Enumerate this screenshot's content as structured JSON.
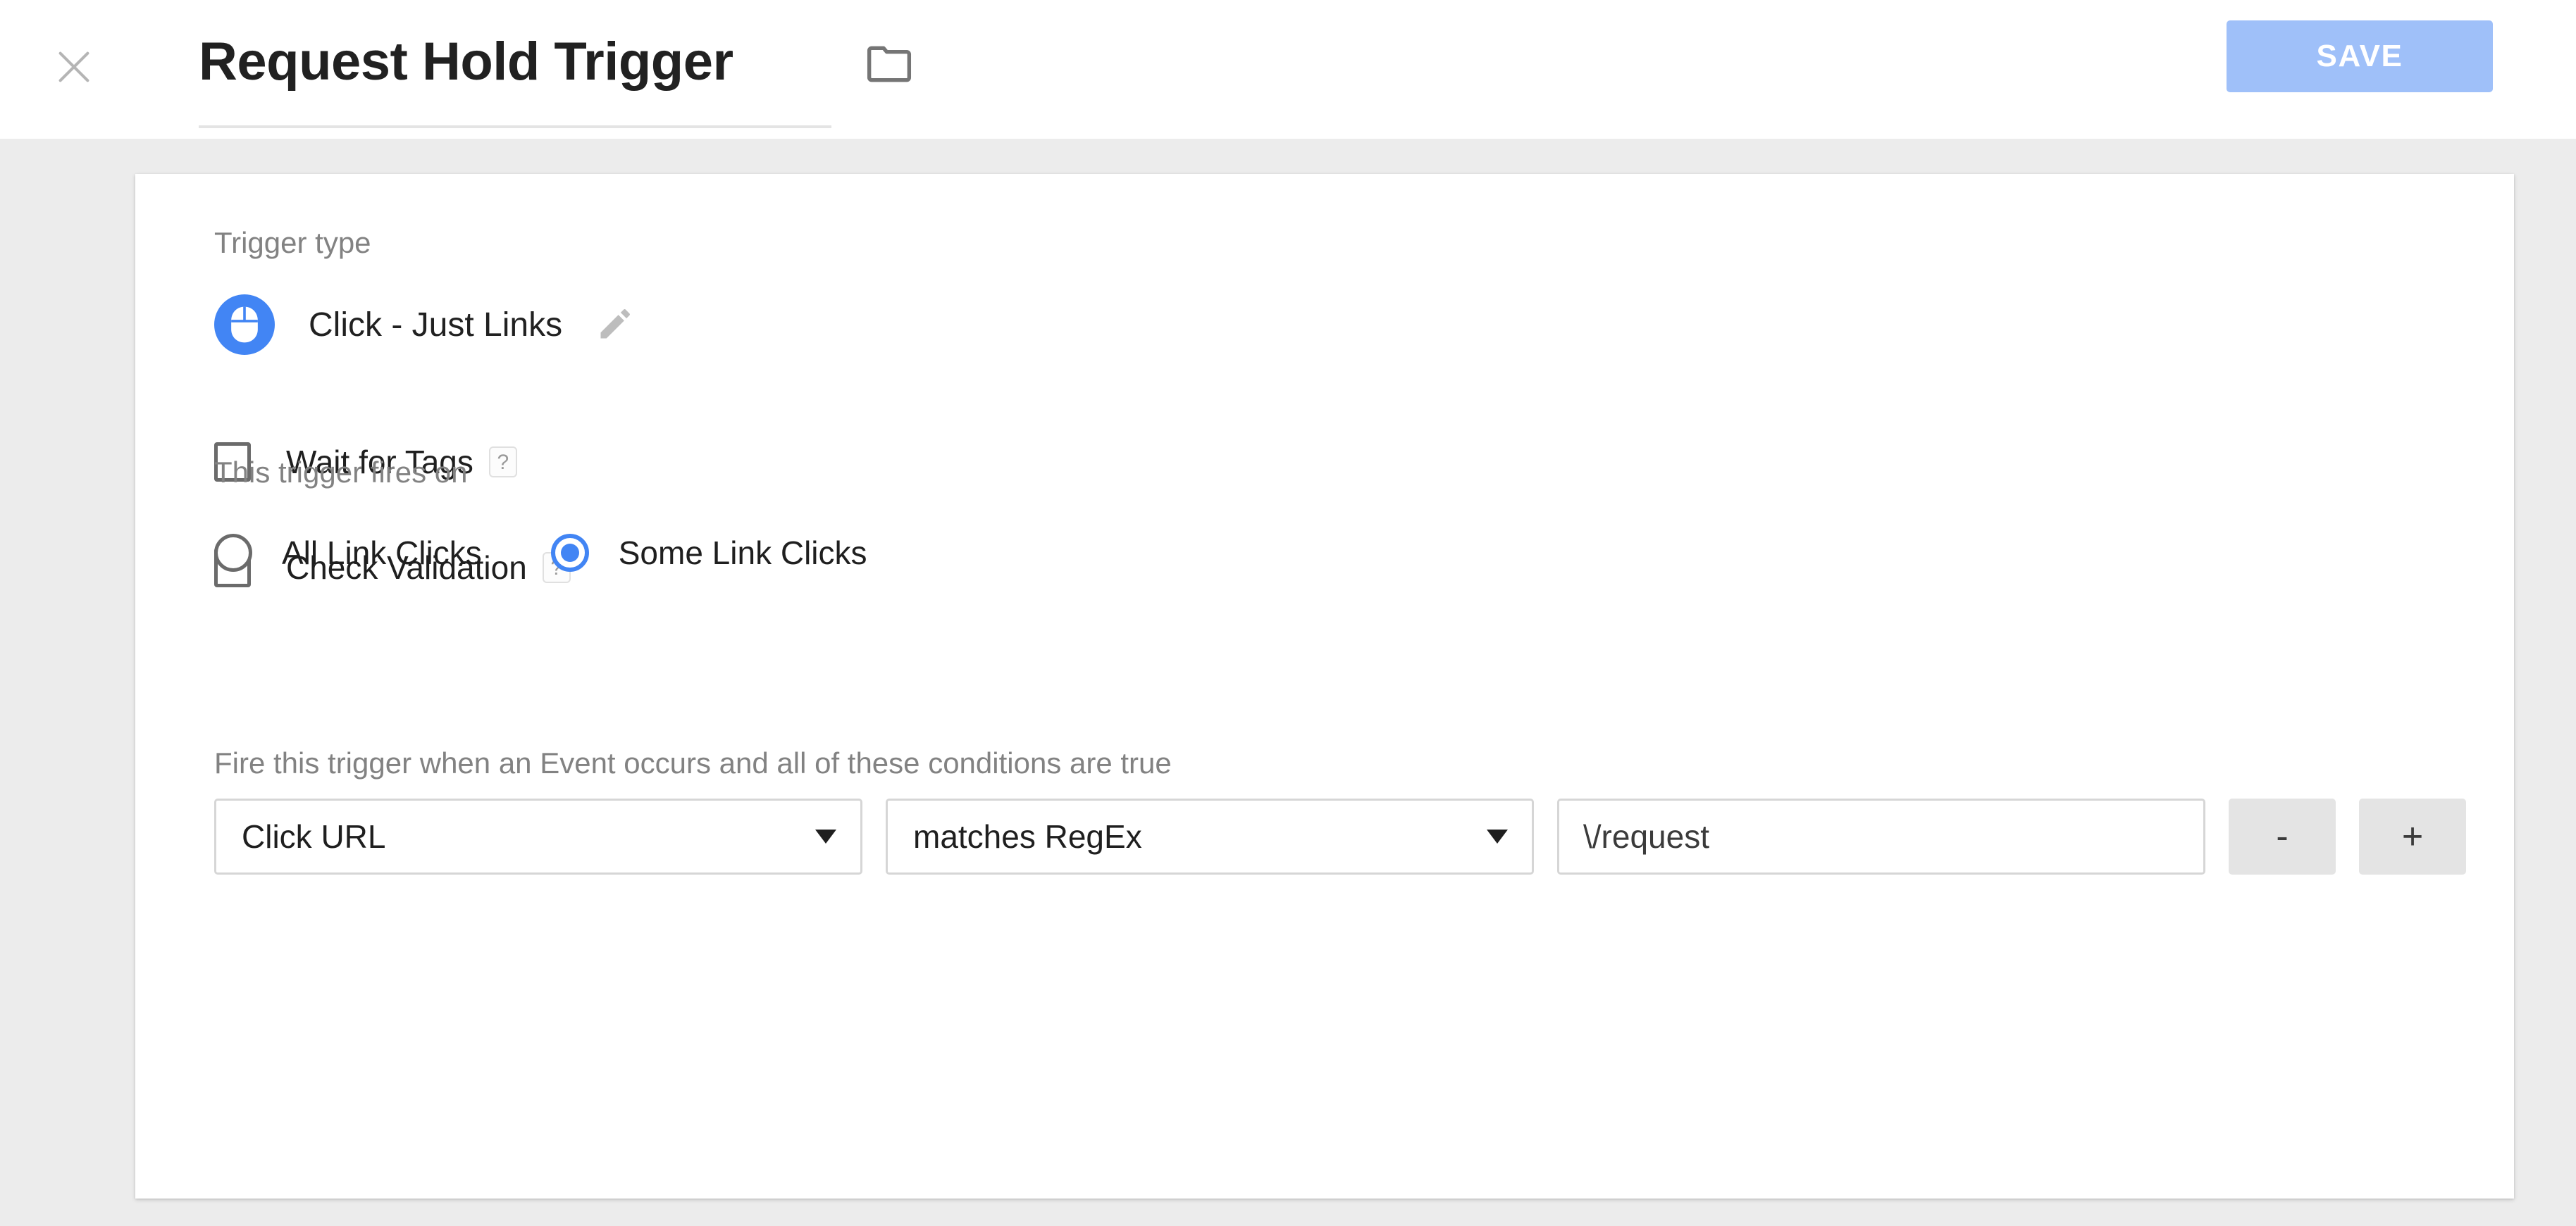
{
  "header": {
    "close_icon": "close-icon",
    "title": "Request Hold Trigger",
    "folder_icon": "folder-icon",
    "save_label": "SAVE",
    "save_color": "#9fc0f9"
  },
  "form": {
    "trigger_type_label": "Trigger type",
    "trigger_type": {
      "icon": "mouse-icon",
      "icon_color": "#4285f4",
      "name": "Click - Just Links",
      "edit_icon": "pencil-icon"
    },
    "options": [
      {
        "label": "Wait for Tags",
        "checked": false,
        "help": "?"
      },
      {
        "label": "Check Validation",
        "checked": false,
        "help": "?"
      }
    ],
    "fires_on_label": "This trigger fires on",
    "fires_on_options": [
      {
        "label": "All Link Clicks",
        "selected": false
      },
      {
        "label": "Some Link Clicks",
        "selected": true
      }
    ],
    "conditions_label": "Fire this trigger when an Event occurs and all of these conditions are true",
    "condition": {
      "variable": "Click URL",
      "operator": "matches RegEx",
      "value": "\\/request",
      "value_placeholder": "",
      "remove_label": "-",
      "add_label": "+"
    }
  }
}
